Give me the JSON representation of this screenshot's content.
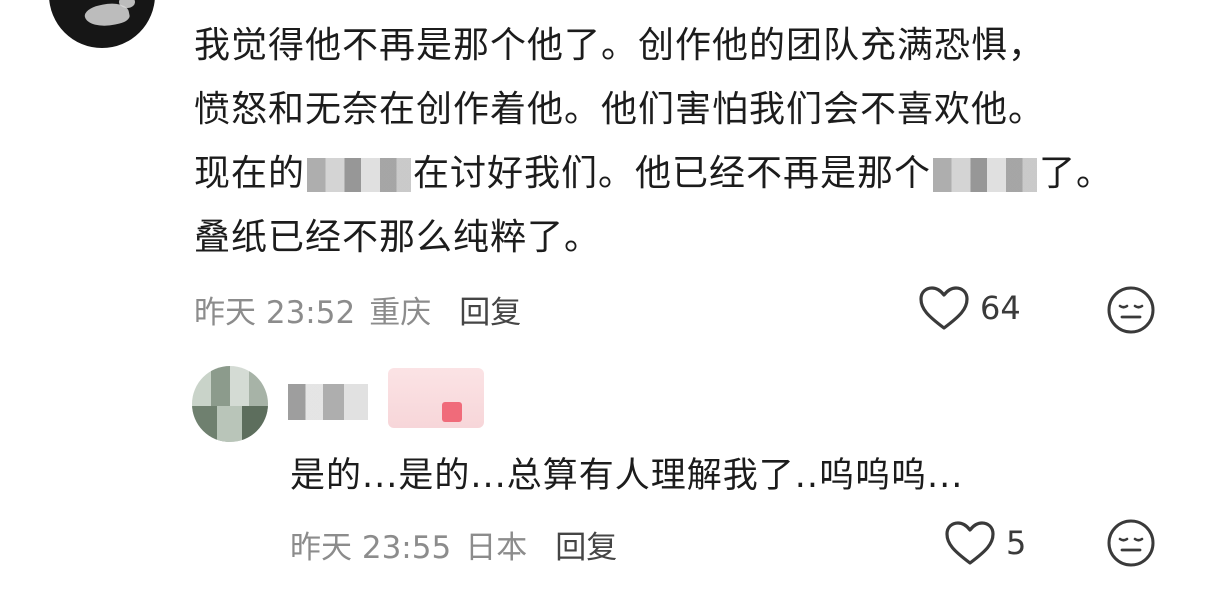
{
  "comment": {
    "lines": [
      "我觉得他不再是那个他了。创作他的团队充满恐惧，",
      "愤怒和无奈在创作着他。他们害怕我们会不喜欢他。",
      [
        "现在的",
        "在讨好我们。他已经不再是那个",
        "了。"
      ],
      "叠纸已经不那么纯粹了。"
    ],
    "time": "昨天 23:52",
    "location": "重庆",
    "reply_label": "回复",
    "likes": "64"
  },
  "reply": {
    "text": "是的...是的...总算有人理解我了..呜呜呜...",
    "time": "昨天 23:55",
    "location": "日本",
    "reply_label": "回复",
    "likes": "5"
  },
  "icons": {
    "like": "heart-outline-icon",
    "emoji": "neutral-face-icon"
  },
  "colors": {
    "text": "#1c1c1c",
    "meta": "#8c8c8c",
    "badge": "#f06b7a"
  }
}
